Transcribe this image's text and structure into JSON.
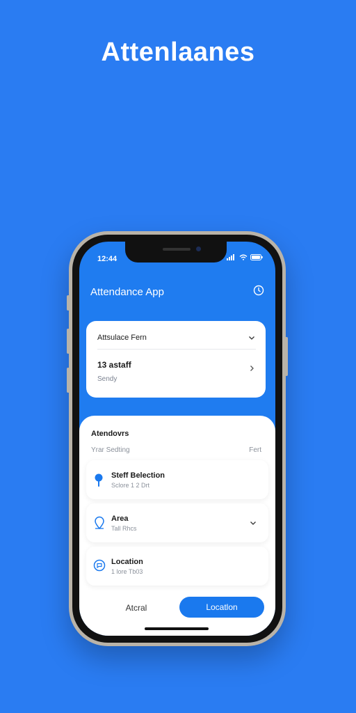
{
  "hero": {
    "title": "Attenlaanes"
  },
  "status_bar": {
    "time": "12:44"
  },
  "app": {
    "title": "Attendance App",
    "icon": "clock-icon"
  },
  "form_card": {
    "title": "Attsulace Fern",
    "staff": "13 astaff",
    "sub": "Sendy"
  },
  "sheet": {
    "title": "Atendovrs",
    "subtitle": "Yrar Sedting",
    "subtitle_right": "Fert",
    "items": [
      {
        "label": "Steff Belection",
        "sub": "Sclore 1 2 Drt",
        "icon": "pin-icon"
      },
      {
        "label": "Area",
        "sub": "Tall Rhcs",
        "icon": "location-outline-icon"
      },
      {
        "label": "Location",
        "sub": "1 lore Tb03",
        "icon": "chat-icon"
      }
    ],
    "cancel_label": "Atcral",
    "location_label": "Locatlon"
  },
  "colors": {
    "background": "#2a7cf2",
    "accent": "#1a79ee",
    "frame": "#b9b3a8"
  }
}
